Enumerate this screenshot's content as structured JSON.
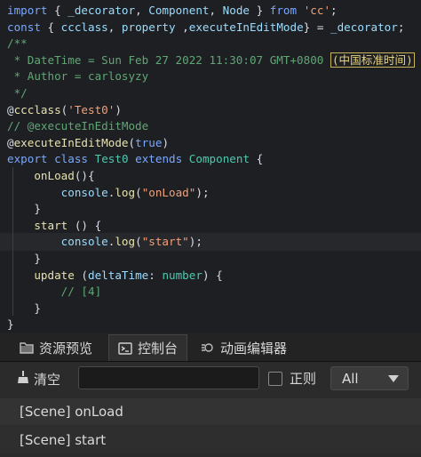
{
  "editor": {
    "lines": [
      [
        [
          "kw",
          "import"
        ],
        [
          "id",
          " { "
        ],
        [
          "prm",
          "_decorator"
        ],
        [
          "id",
          ", "
        ],
        [
          "prm",
          "Component"
        ],
        [
          "id",
          ", "
        ],
        [
          "prm",
          "Node"
        ],
        [
          "id",
          " } "
        ],
        [
          "kw",
          "from"
        ],
        [
          "id",
          " "
        ],
        [
          "str",
          "'cc'"
        ],
        [
          "id",
          ";"
        ]
      ],
      [
        [
          "kw",
          "const"
        ],
        [
          "id",
          " { "
        ],
        [
          "prm",
          "ccclass"
        ],
        [
          "id",
          ", "
        ],
        [
          "prm",
          "property"
        ],
        [
          "id",
          " ,"
        ],
        [
          "prm",
          "executeInEditMode"
        ],
        [
          "id",
          "} = "
        ],
        [
          "prm",
          "_decorator"
        ],
        [
          "id",
          ";"
        ]
      ],
      [
        [
          "cm",
          "/**"
        ]
      ],
      [
        [
          "cm",
          " * DateTime = Sun Feb 27 2022 11:30:07 GMT+0800 "
        ],
        [
          "box",
          "(中国标准时间)"
        ]
      ],
      [
        [
          "cm",
          " * Author = carlosyzy"
        ]
      ],
      [
        [
          "cm",
          " */"
        ]
      ],
      [
        [
          "id",
          "@"
        ],
        [
          "fn",
          "ccclass"
        ],
        [
          "id",
          "("
        ],
        [
          "str",
          "'Test0'"
        ],
        [
          "id",
          ")"
        ]
      ],
      [
        [
          "cm",
          "// @executeInEditMode"
        ]
      ],
      [
        [
          "id",
          "@"
        ],
        [
          "fn",
          "executeInEditMode"
        ],
        [
          "id",
          "("
        ],
        [
          "kw",
          "true"
        ],
        [
          "id",
          ")"
        ]
      ],
      [
        [
          "kw",
          "export"
        ],
        [
          "id",
          " "
        ],
        [
          "kw",
          "class"
        ],
        [
          "id",
          " "
        ],
        [
          "cls",
          "Test0"
        ],
        [
          "id",
          " "
        ],
        [
          "kw",
          "extends"
        ],
        [
          "id",
          " "
        ],
        [
          "cls",
          "Component"
        ],
        [
          "id",
          " {"
        ]
      ],
      [
        [
          "id",
          "    "
        ],
        [
          "fn",
          "onLoad"
        ],
        [
          "id",
          "(){"
        ]
      ],
      [
        [
          "id",
          "        "
        ],
        [
          "prm",
          "console"
        ],
        [
          "id",
          "."
        ],
        [
          "fn",
          "log"
        ],
        [
          "id",
          "("
        ],
        [
          "str",
          "\"onLoad\""
        ],
        [
          "id",
          ");"
        ]
      ],
      [
        [
          "id",
          "    }"
        ]
      ],
      [
        [
          "id",
          "    "
        ],
        [
          "fn",
          "start"
        ],
        [
          "id",
          " () {"
        ]
      ],
      [
        [
          "id",
          "        "
        ],
        [
          "prm",
          "console"
        ],
        [
          "id",
          "."
        ],
        [
          "fn",
          "log"
        ],
        [
          "id",
          "("
        ],
        [
          "str",
          "\"start\""
        ],
        [
          "id",
          ");"
        ]
      ],
      [
        [
          "id",
          "    }"
        ]
      ],
      [
        [
          "id",
          "    "
        ],
        [
          "fn",
          "update"
        ],
        [
          "id",
          " ("
        ],
        [
          "prm",
          "deltaTime"
        ],
        [
          "id",
          ": "
        ],
        [
          "cls",
          "number"
        ],
        [
          "id",
          ") {"
        ]
      ],
      [
        [
          "id",
          "        "
        ],
        [
          "cm",
          "// [4]"
        ]
      ],
      [
        [
          "id",
          "    }"
        ]
      ],
      [
        [
          "id",
          "}"
        ]
      ]
    ],
    "highlighted_line": 14
  },
  "panel": {
    "tabs": [
      {
        "label": "资源预览",
        "icon": "folder-icon",
        "active": false
      },
      {
        "label": "控制台",
        "icon": "terminal-icon",
        "active": true
      },
      {
        "label": "动画编辑器",
        "icon": "animation-icon",
        "active": false
      }
    ],
    "toolbar": {
      "clear_label": "清空",
      "search_value": "",
      "regex_label": "正则",
      "filter_value": "All"
    },
    "logs": [
      "[Scene] onLoad",
      "[Scene] start"
    ]
  },
  "colors": {
    "accent_box": "#c9b45a"
  }
}
